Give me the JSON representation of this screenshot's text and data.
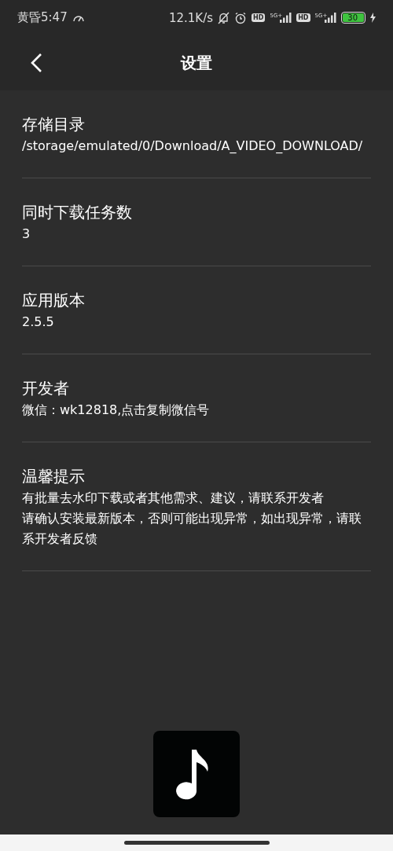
{
  "status_bar": {
    "time": "黄昏5:47",
    "speed": "12.1K/s",
    "hd_badges": [
      "HD",
      "HD"
    ],
    "network_labels": [
      "5G+",
      "5G+"
    ],
    "battery": "30"
  },
  "header": {
    "title": "设置"
  },
  "settings": [
    {
      "title": "存储目录",
      "lines": [
        "/storage/emulated/0/Download/A_VIDEO_DOWNLOAD/"
      ]
    },
    {
      "title": "同时下载任务数",
      "lines": [
        "3"
      ]
    },
    {
      "title": "应用版本",
      "lines": [
        "2.5.5"
      ]
    },
    {
      "title": "开发者",
      "lines": [
        "微信：wk12818,点击复制微信号"
      ]
    },
    {
      "title": "温馨提示",
      "lines": [
        "有批量去水印下载或者其他需求、建议，请联系开发者",
        "请确认安装最新版本，否则可能出现异常，如出现异常，请联系开发者反馈"
      ]
    }
  ]
}
